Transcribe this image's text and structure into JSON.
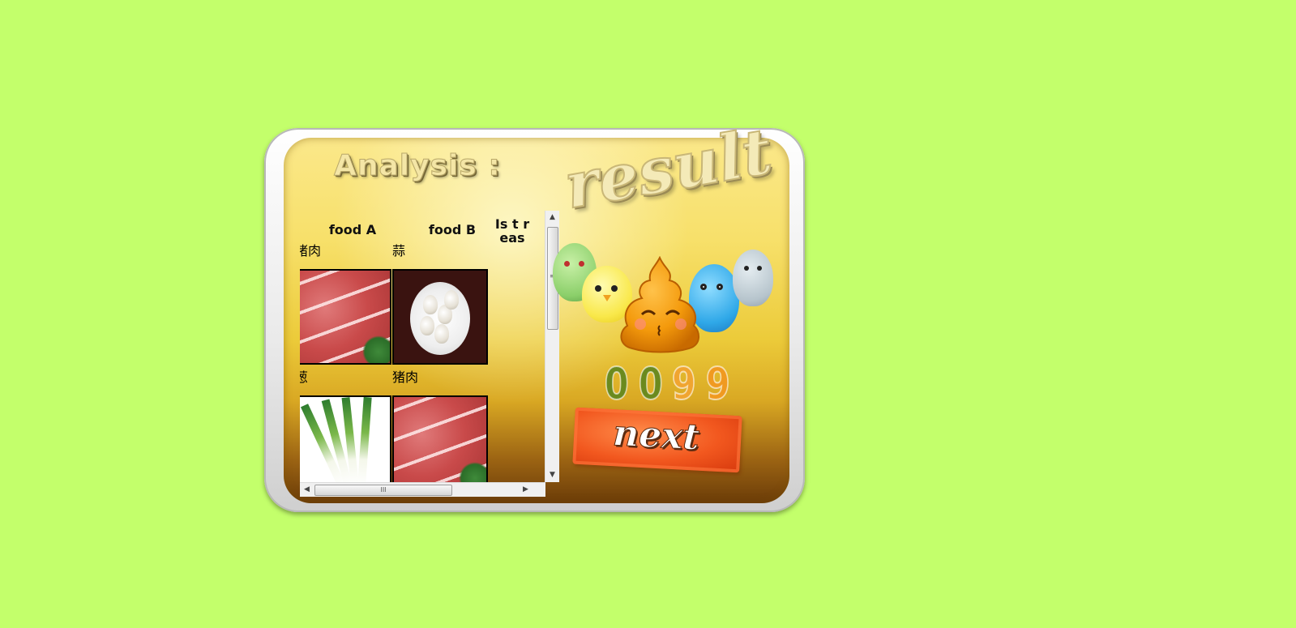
{
  "analysis": {
    "title": "Analysis :"
  },
  "result": {
    "title": "result"
  },
  "table": {
    "headers": [
      "food A",
      "food B",
      "Is t reas"
    ],
    "rows": [
      {
        "food_a": "猪肉",
        "food_b": "蒜"
      },
      {
        "food_a": "葱",
        "food_b": "猪肉"
      }
    ]
  },
  "score": {
    "digits": [
      "0",
      "0",
      "9",
      "9"
    ]
  },
  "next": {
    "label": "next"
  },
  "scrollbars": {
    "h_thumb_label": "III",
    "v_thumb_label": "≡"
  }
}
